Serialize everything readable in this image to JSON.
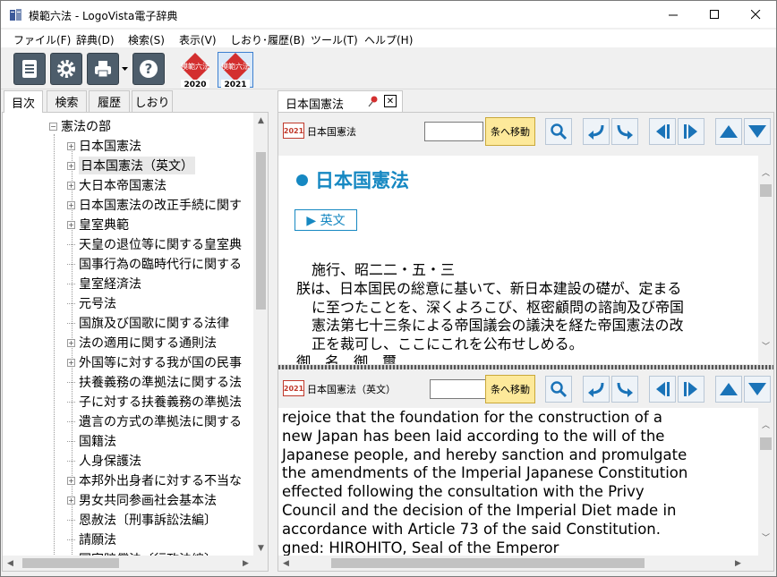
{
  "window": {
    "title": "模範六法 - LogoVista電子辞典"
  },
  "menu": [
    "ファイル(F)",
    "辞典(D)",
    "検索(S)",
    "表示(V)",
    "しおり･履歴(B)",
    "ツール(T)",
    "ヘルプ(H)"
  ],
  "toolbar": {
    "book1": {
      "name": "模範六法",
      "year": "2020"
    },
    "book2": {
      "name": "模範六法",
      "year": "2021"
    }
  },
  "left_tabs": [
    "目次",
    "検索",
    "履歴",
    "しおり"
  ],
  "tree": {
    "root": "憲法の部",
    "items": [
      {
        "label": "日本国憲法",
        "expandable": true
      },
      {
        "label": "日本国憲法（英文）",
        "expandable": true,
        "selected": true
      },
      {
        "label": "大日本帝国憲法",
        "expandable": true
      },
      {
        "label": "日本国憲法の改正手続に関す",
        "expandable": true
      },
      {
        "label": "皇室典範",
        "expandable": true
      },
      {
        "label": "天皇の退位等に関する皇室典",
        "expandable": false
      },
      {
        "label": "国事行為の臨時代行に関する",
        "expandable": false
      },
      {
        "label": "皇室経済法",
        "expandable": false
      },
      {
        "label": "元号法",
        "expandable": false
      },
      {
        "label": "国旗及び国歌に関する法律",
        "expandable": false
      },
      {
        "label": "法の適用に関する通則法",
        "expandable": true
      },
      {
        "label": "外国等に対する我が国の民事",
        "expandable": true
      },
      {
        "label": "扶養義務の準拠法に関する法",
        "expandable": false
      },
      {
        "label": "子に対する扶養義務の準拠法",
        "expandable": false
      },
      {
        "label": "遺言の方式の準拠法に関する",
        "expandable": false
      },
      {
        "label": "国籍法",
        "expandable": false
      },
      {
        "label": "人身保護法",
        "expandable": false
      },
      {
        "label": "本邦外出身者に対する不当な",
        "expandable": true
      },
      {
        "label": "男女共同参画社会基本法",
        "expandable": true
      },
      {
        "label": "恩赦法〔刑事訴訟法編〕",
        "expandable": false
      },
      {
        "label": "請願法",
        "expandable": false
      },
      {
        "label": "国家賠償法〔行政法編〕",
        "expandable": false
      }
    ]
  },
  "right_tab": {
    "label": "日本国憲法"
  },
  "pane1": {
    "edition": "2021",
    "title": "日本国憲法",
    "jump_label": "条へ移動",
    "heading": "日本国憲法",
    "english_link": "▶ 英文",
    "lines": [
      "施行、昭二二・五・三",
      "朕は、日本国民の総意に基いて、新日本建設の礎が、定まる",
      "に至つたことを、深くよろこび、枢密顧問の諮詢及び帝国",
      "憲法第七十三条による帝国議会の議決を経た帝国憲法の改",
      "正を裁可し、ここにこれを公布せしめる。",
      "御　名　御　璽"
    ]
  },
  "pane2": {
    "edition": "2021",
    "title": "日本国憲法（英文）",
    "jump_label": "条へ移動",
    "lines": [
      "rejoice that the foundation for the construction of a",
      "new Japan has been laid according to the will of the",
      "Japanese people, and hereby sanction and promulgate",
      "the amendments of the Imperial Japanese Constitution",
      "effected following the consultation with the Privy",
      "Council and the decision of the Imperial Diet made in",
      "accordance with Article 73 of the said Constitution.",
      "gned: HIROHITO, Seal of the Emperor"
    ]
  },
  "colors": {
    "accent": "#1688c2",
    "jump_button": "#fde99a",
    "nav_arrow": "#1a73b8"
  }
}
